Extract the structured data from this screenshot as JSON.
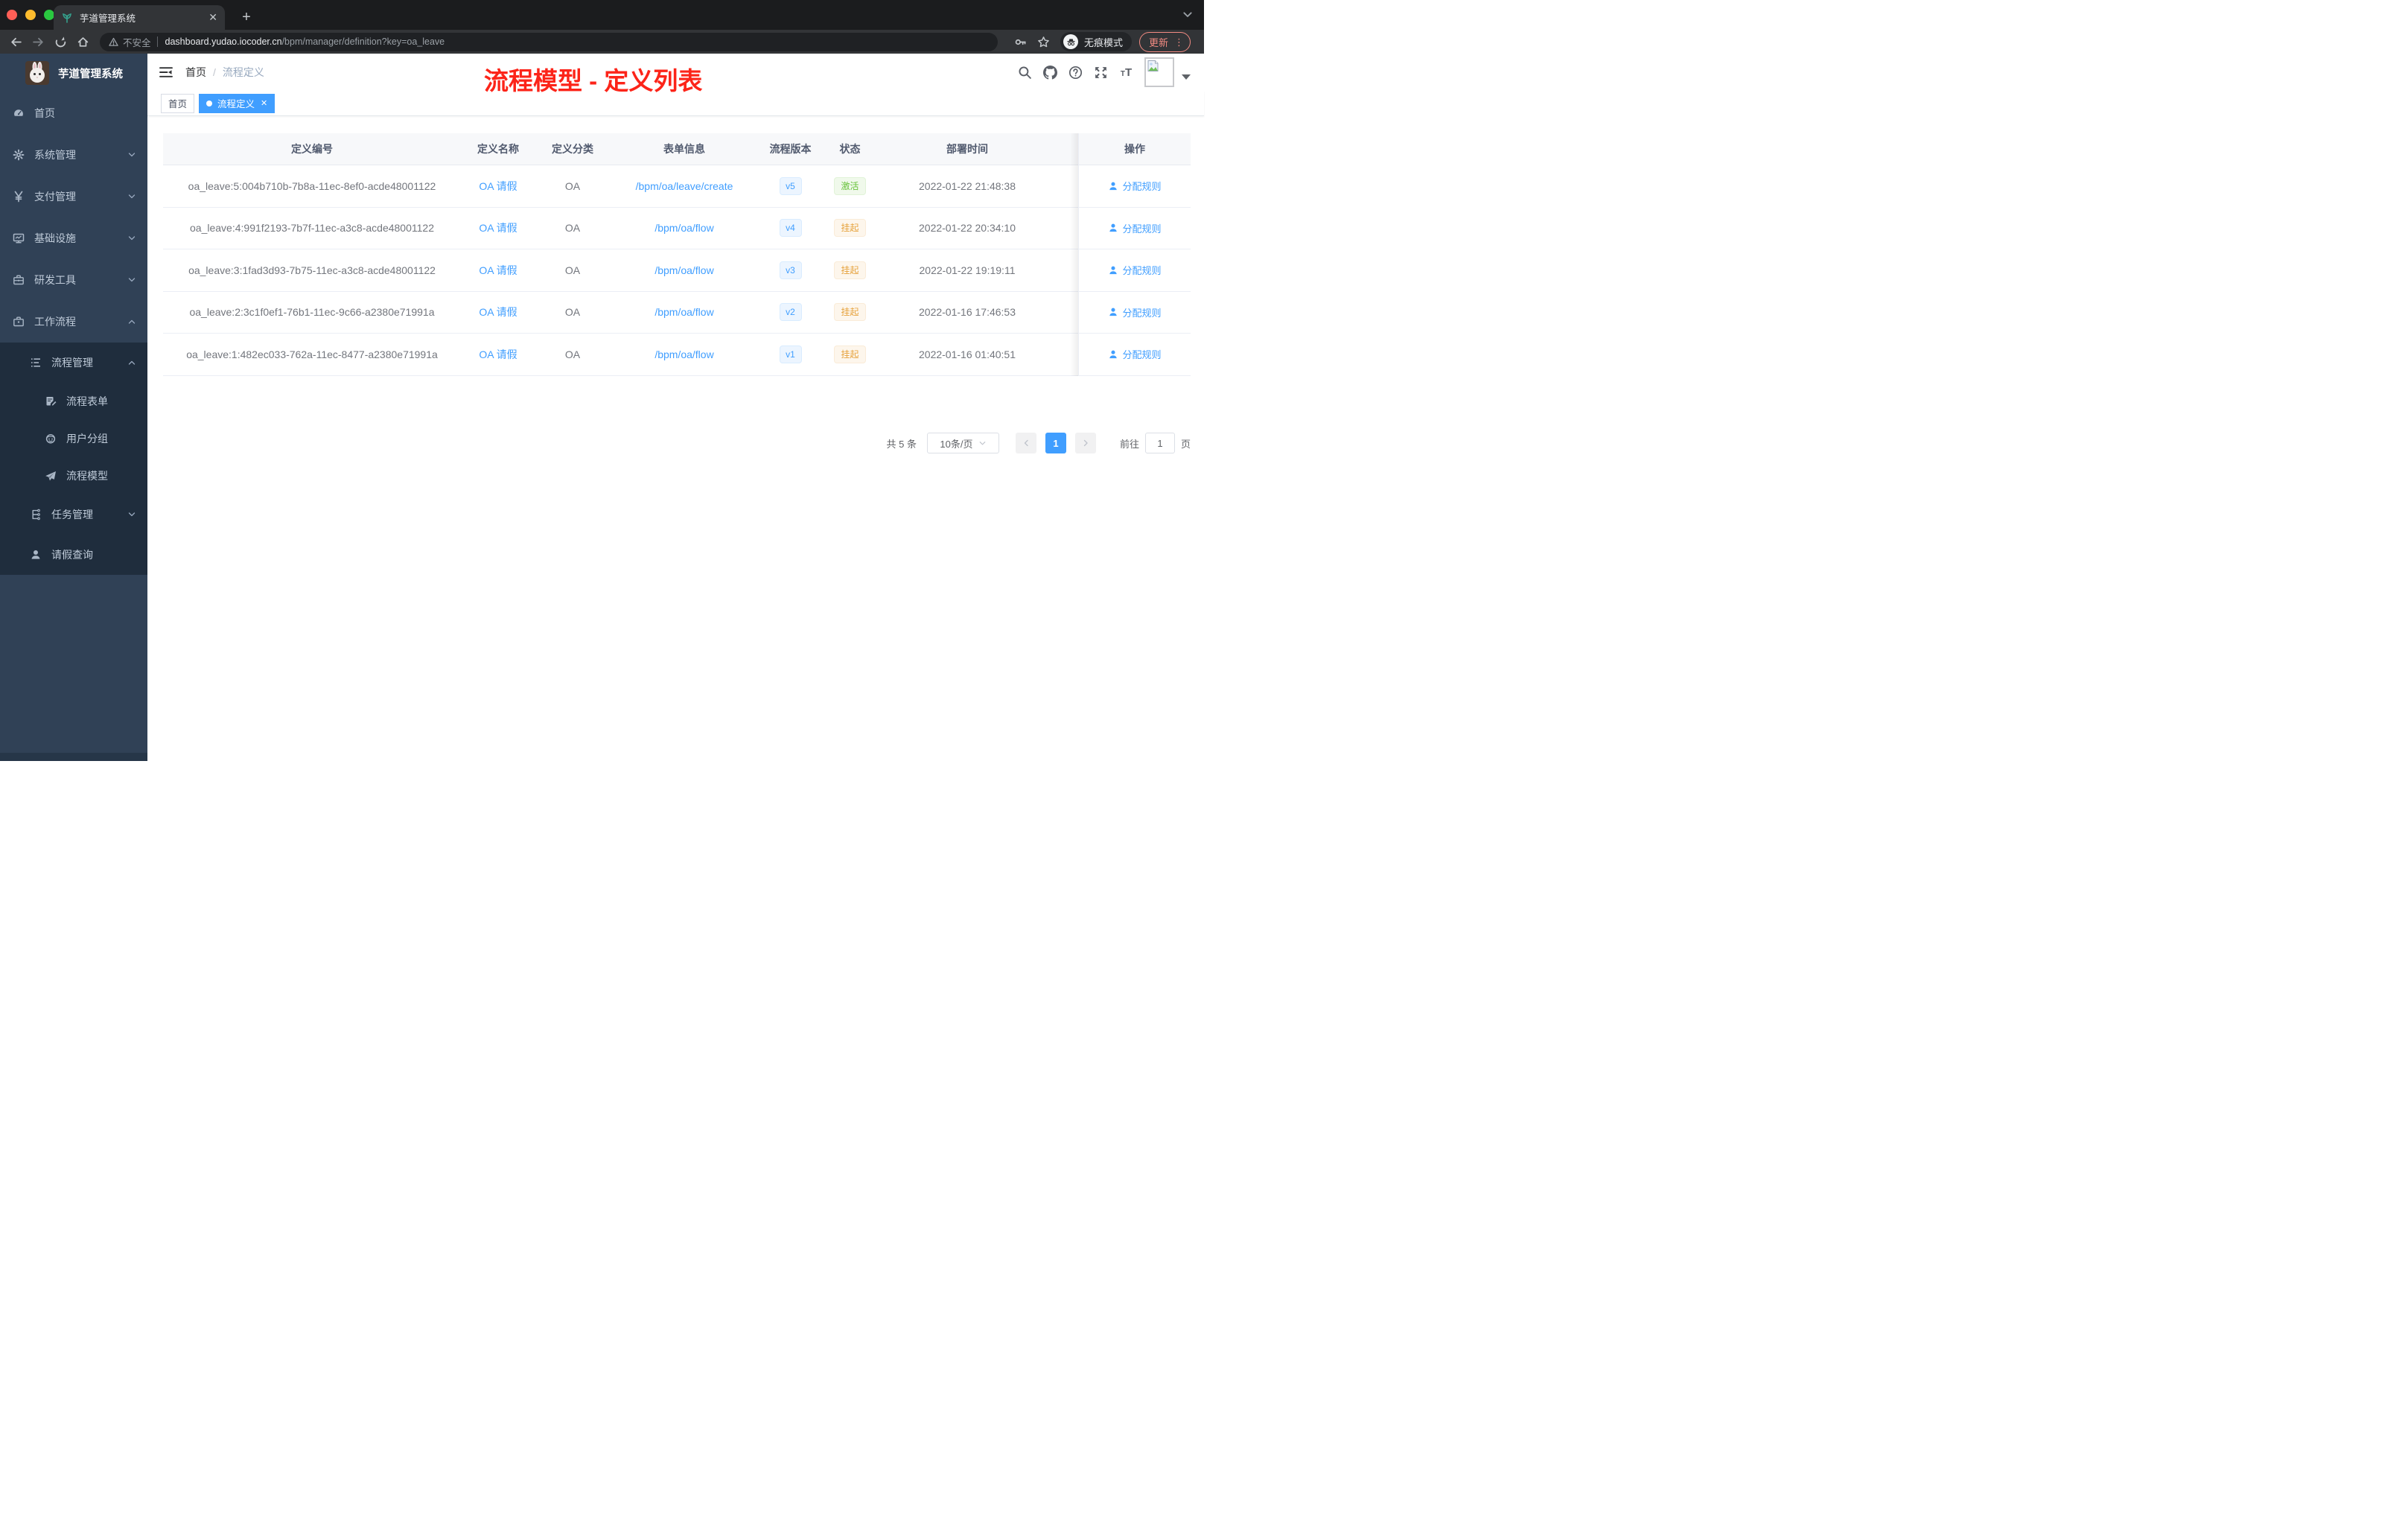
{
  "browser": {
    "tab_title": "芋道管理系统",
    "security_label": "不安全",
    "url_domain": "dashboard.yudao.iocoder.cn",
    "url_path": "/bpm/manager/definition?key=oa_leave",
    "incognito_label": "无痕模式",
    "update_label": "更新"
  },
  "sidebar": {
    "logo_title": "芋道管理系统",
    "menu": [
      {
        "label": "首页",
        "icon": "dashboard-icon",
        "level": 1,
        "dark": false,
        "caret": ""
      },
      {
        "label": "系统管理",
        "icon": "gear-icon",
        "level": 1,
        "dark": false,
        "caret": "down"
      },
      {
        "label": "支付管理",
        "icon": "yen-icon",
        "level": 1,
        "dark": false,
        "caret": "down"
      },
      {
        "label": "基础设施",
        "icon": "monitor-icon",
        "level": 1,
        "dark": false,
        "caret": "down"
      },
      {
        "label": "研发工具",
        "icon": "toolbox-icon",
        "level": 1,
        "dark": false,
        "caret": "down"
      },
      {
        "label": "工作流程",
        "icon": "briefcase-icon",
        "level": 1,
        "dark": false,
        "caret": "up"
      },
      {
        "label": "流程管理",
        "icon": "list-icon",
        "level": 2,
        "dark": true,
        "caret": "up"
      },
      {
        "label": "流程表单",
        "icon": "form-icon",
        "level": 3,
        "dark": true,
        "caret": ""
      },
      {
        "label": "用户分组",
        "icon": "group-icon",
        "level": 3,
        "dark": true,
        "caret": ""
      },
      {
        "label": "流程模型",
        "icon": "paper-plane-icon",
        "level": 3,
        "dark": true,
        "caret": ""
      },
      {
        "label": "任务管理",
        "icon": "task-tree-icon",
        "level": 2,
        "dark": true,
        "caret": "down"
      },
      {
        "label": "请假查询",
        "icon": "user-icon",
        "level": 2,
        "dark": true,
        "caret": ""
      }
    ]
  },
  "header": {
    "breadcrumb_home": "首页",
    "breadcrumb_separator": "/",
    "breadcrumb_current": "流程定义",
    "annotation": "流程模型 - 定义列表",
    "annotation_color": "#fc2419"
  },
  "tags": [
    {
      "label": "首页",
      "active": false
    },
    {
      "label": "流程定义",
      "active": true
    }
  ],
  "table": {
    "headers": [
      "定义编号",
      "定义名称",
      "定义分类",
      "表单信息",
      "流程版本",
      "状态",
      "部署时间",
      "操作"
    ],
    "action_label": "分配规则",
    "rows": [
      {
        "id": "oa_leave:5:004b710b-7b8a-11ec-8ef0-acde48001122",
        "name": "OA 请假",
        "category": "OA",
        "form": "/bpm/oa/leave/create",
        "version": "v5",
        "status": "激活",
        "status_type": "active",
        "time": "2022-01-22 21:48:38"
      },
      {
        "id": "oa_leave:4:991f2193-7b7f-11ec-a3c8-acde48001122",
        "name": "OA 请假",
        "category": "OA",
        "form": "/bpm/oa/flow",
        "version": "v4",
        "status": "挂起",
        "status_type": "suspended",
        "time": "2022-01-22 20:34:10"
      },
      {
        "id": "oa_leave:3:1fad3d93-7b75-11ec-a3c8-acde48001122",
        "name": "OA 请假",
        "category": "OA",
        "form": "/bpm/oa/flow",
        "version": "v3",
        "status": "挂起",
        "status_type": "suspended",
        "time": "2022-01-22 19:19:11"
      },
      {
        "id": "oa_leave:2:3c1f0ef1-76b1-11ec-9c66-a2380e71991a",
        "name": "OA 请假",
        "category": "OA",
        "form": "/bpm/oa/flow",
        "version": "v2",
        "status": "挂起",
        "status_type": "suspended",
        "time": "2022-01-16 17:46:53"
      },
      {
        "id": "oa_leave:1:482ec033-762a-11ec-8477-a2380e71991a",
        "name": "OA 请假",
        "category": "OA",
        "form": "/bpm/oa/flow",
        "version": "v1",
        "status": "挂起",
        "status_type": "suspended",
        "time": "2022-01-16 01:40:51"
      }
    ]
  },
  "pagination": {
    "total_label": "共 5 条",
    "page_size_label": "10条/页",
    "current_page": "1",
    "goto_label": "前往",
    "goto_value": "1",
    "unit_label": "页"
  },
  "colors": {
    "accent": "#409eff",
    "sidebar_bg": "#304156",
    "sidebar_submenu_bg": "#1f2d3d",
    "status_active": "#67c23a",
    "status_suspended": "#e6a23c",
    "annotation_red": "#fc2419",
    "update_button": "#f28b82"
  }
}
